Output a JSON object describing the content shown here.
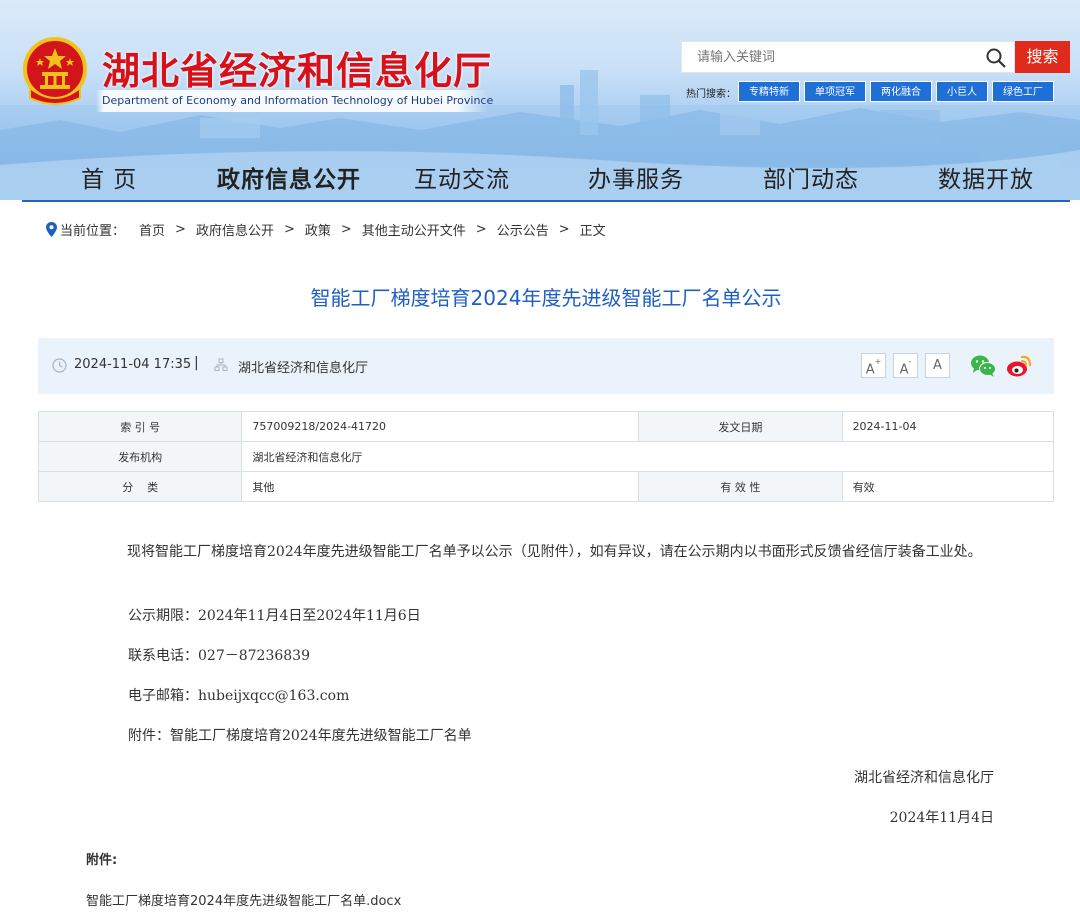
{
  "header": {
    "site_title": "湖北省经济和信息化厅",
    "site_subtitle": "Department of Economy and Information Technology of Hubei Province",
    "search_placeholder": "请输入关键词",
    "search_button": "搜索",
    "hot_label": "热门搜索：",
    "hot_tags": [
      "专精特新",
      "单项冠军",
      "两化融合",
      "小巨人",
      "绿色工厂"
    ],
    "brand_red": "#d6111a",
    "accent_blue": "#1e6fd6"
  },
  "nav": {
    "items": [
      "首  页",
      "政府信息公开",
      "互动交流",
      "办事服务",
      "部门动态",
      "数据开放"
    ]
  },
  "breadcrumb": {
    "label": "当前位置：",
    "items": [
      "首页",
      "政府信息公开",
      "政策",
      "其他主动公开文件",
      "公示公告",
      "正文"
    ]
  },
  "article": {
    "title": "智能工厂梯度培育2024年度先进级智能工厂名单公示",
    "date": "2024-11-04 17:35",
    "source": "湖北省经济和信息化厅",
    "font_sizes": [
      "A",
      "A",
      "A"
    ],
    "share": [
      "wechat-icon",
      "weibo-icon"
    ]
  },
  "info_table": {
    "index_label": "索 引 号",
    "index_value": "757009218/2024-41720",
    "date_label": "发文日期",
    "date_value": "2024-11-04",
    "org_label": "发布机构",
    "org_value": "湖北省经济和信息化厅",
    "category_label": "分    类",
    "category_value": "其他",
    "validity_label": "有 效 性",
    "validity_value": "有效"
  },
  "body": {
    "p1": "现将智能工厂梯度培育2024年度先进级智能工厂名单予以公示（见附件），如有异议，请在公示期内以书面形式反馈省经信厅装备工业处。",
    "p2": "公示期限：2024年11月4日至2024年11月6日",
    "p3": "联系电话：027－87236839",
    "p4": "电子邮箱：hubeijxqcc@163.com",
    "p5": "附件：智能工厂梯度培育2024年度先进级智能工厂名单",
    "signature": "湖北省经济和信息化厅",
    "sign_date": "2024年11月4日",
    "attachments_label": "附件:",
    "attachment_file": "智能工厂梯度培育2024年度先进级智能工厂名单.docx"
  }
}
